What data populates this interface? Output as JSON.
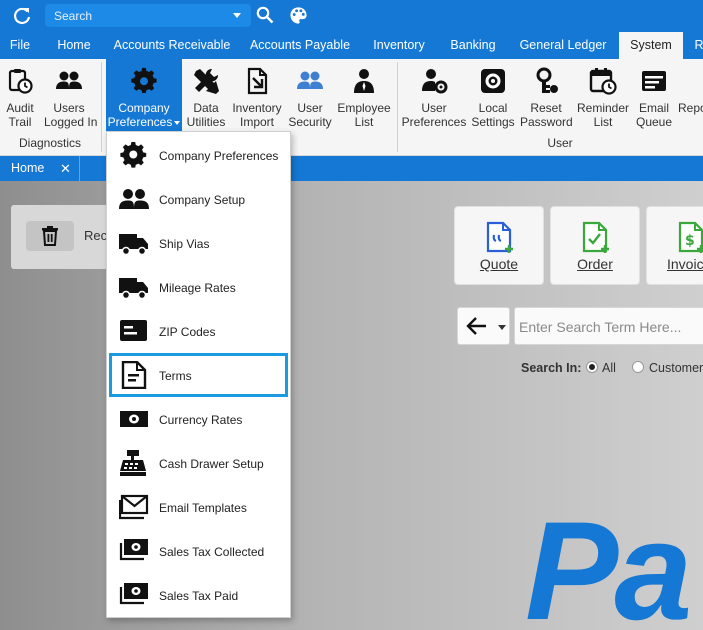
{
  "titlebar": {
    "search_placeholder": "Search"
  },
  "menu_tabs": [
    "File",
    "Home",
    "Accounts Receivable",
    "Accounts Payable",
    "Inventory",
    "Banking",
    "General Ledger",
    "System",
    "R"
  ],
  "ribbon": {
    "diagnostics": {
      "items": [
        {
          "line1": "Audit",
          "line2": "Trail"
        },
        {
          "line1": "Users",
          "line2": "Logged In"
        }
      ],
      "group_label": "Diagnostics"
    },
    "company": {
      "items": [
        {
          "line1": "Company",
          "line2": "Preferences"
        },
        {
          "line1": "Data",
          "line2": "Utilities"
        },
        {
          "line1": "Inventory",
          "line2": "Import"
        },
        {
          "line1": "User",
          "line2": "Security"
        },
        {
          "line1": "Employee",
          "line2": "List"
        }
      ]
    },
    "user": {
      "items": [
        {
          "line1": "User",
          "line2": "Preferences"
        },
        {
          "line1": "Local",
          "line2": "Settings"
        },
        {
          "line1": "Reset",
          "line2": "Password"
        },
        {
          "line1": "Reminder",
          "line2": "List"
        },
        {
          "line1": "Email",
          "line2": "Queue"
        },
        {
          "line1": "Repo",
          "line2": ""
        }
      ],
      "group_label": "User"
    }
  },
  "doc_tab": {
    "label": "Home",
    "close": "✕"
  },
  "home": {
    "recent_label": "Rec",
    "actions": [
      {
        "label": "Quote",
        "color": "#2a5fd8"
      },
      {
        "label": "Order",
        "color": "#3aa83a"
      },
      {
        "label": "Invoic",
        "color": "#3aa83a"
      }
    ],
    "search_placeholder": "Enter Search Term Here...",
    "search_in_label": "Search In:",
    "search_in_options": [
      "All",
      "Customer"
    ],
    "search_in_selected": "All",
    "brand_text": "Pa"
  },
  "dropdown": {
    "items": [
      {
        "label": "Company Preferences",
        "icon": "gear-icon"
      },
      {
        "label": "Company Setup",
        "icon": "people-icon"
      },
      {
        "label": "Ship Vias",
        "icon": "truck-icon"
      },
      {
        "label": "Mileage Rates",
        "icon": "truck-icon"
      },
      {
        "label": "ZIP Codes",
        "icon": "card-icon"
      },
      {
        "label": "Terms",
        "icon": "document-icon"
      },
      {
        "label": "Currency Rates",
        "icon": "money-icon"
      },
      {
        "label": "Cash Drawer Setup",
        "icon": "cash-register-icon"
      },
      {
        "label": "Email Templates",
        "icon": "envelope-icon"
      },
      {
        "label": "Sales Tax Collected",
        "icon": "money-stack-icon"
      },
      {
        "label": "Sales Tax Paid",
        "icon": "money-stack-icon"
      }
    ],
    "focused": "Terms"
  },
  "colors": {
    "accent": "#1478d4",
    "focus_outline": "#1a9be0"
  }
}
